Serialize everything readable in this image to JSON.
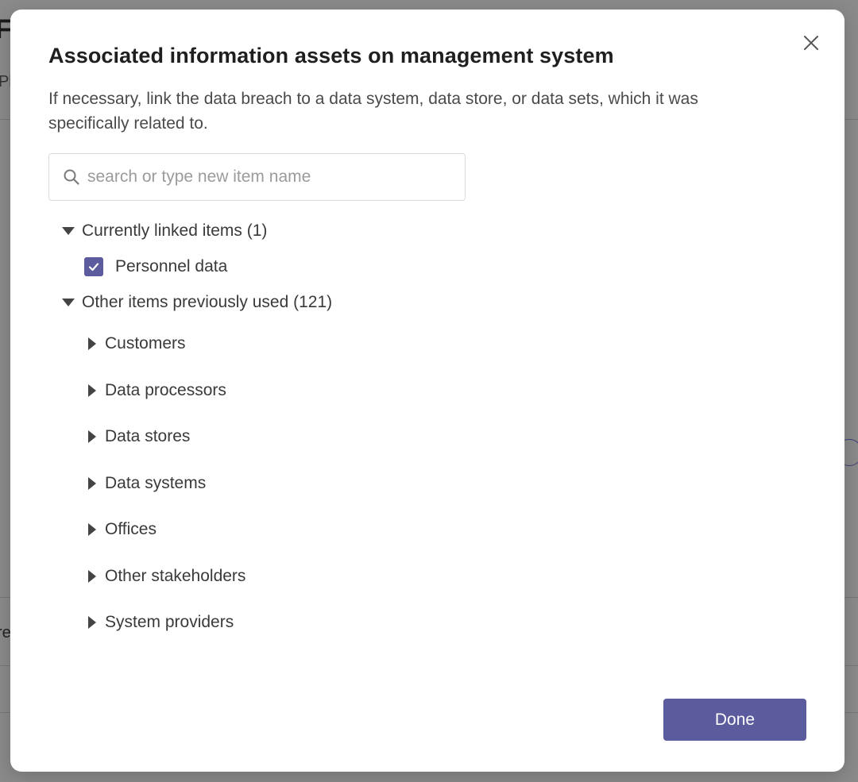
{
  "background": {
    "title_fragment": "Fi",
    "subtitle_fragment": "Ple",
    "row_fragment": "re"
  },
  "modal": {
    "title": "Associated information assets on management system",
    "description": "If necessary, link the data breach to a data system, data store, or data sets, which it was specifically related to.",
    "close_icon": "close-icon",
    "search": {
      "placeholder": "search or type new item name",
      "value": "",
      "icon": "search-icon"
    },
    "linked_group": {
      "label": "Currently linked items (1)",
      "expanded": true,
      "items": [
        {
          "label": "Personnel data",
          "checked": true
        }
      ]
    },
    "other_group": {
      "label": "Other items previously used (121)",
      "expanded": true,
      "categories": [
        {
          "label": "Customers",
          "expanded": false
        },
        {
          "label": "Data processors",
          "expanded": false
        },
        {
          "label": "Data stores",
          "expanded": false
        },
        {
          "label": "Data systems",
          "expanded": false
        },
        {
          "label": "Offices",
          "expanded": false
        },
        {
          "label": "Other stakeholders",
          "expanded": false
        },
        {
          "label": "System providers",
          "expanded": false
        }
      ]
    },
    "done_label": "Done"
  },
  "colors": {
    "accent": "#5b5b9e",
    "overlay": "#8a8a8a",
    "modal_bg": "#ffffff"
  }
}
